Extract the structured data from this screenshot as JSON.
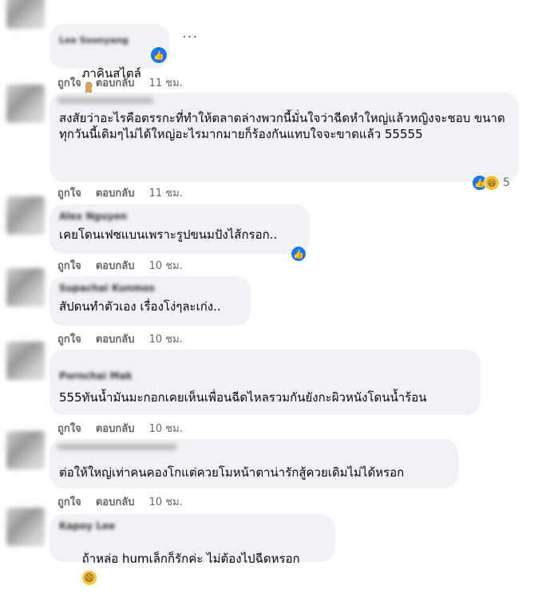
{
  "comments": [
    {
      "author": "Lee Soonyang",
      "text": "ภาคินสไตล์",
      "time": "11 ชม.",
      "emoji": "peanut-icon",
      "reactions": {
        "types": [
          "like-icon"
        ],
        "count": ""
      }
    },
    {
      "author": "",
      "text": "สงสัยว่าอะไรคือตรรกะที่ทำให้ตลาดล่างพวกนี้มั่นใจว่าฉีดหำใหญ่แล้วหญิงจะชอบ ขนาดทุกวันนี้เดิมๆไม่ได้ใหญ่อะไรมากมายก็ร้องกันแทบใจจะขาดแล้ว 55555",
      "time": "11 ชม.",
      "reactions": {
        "types": [
          "like-icon",
          "haha-icon"
        ],
        "count": "5"
      }
    },
    {
      "author": "Alex Nguyen",
      "text": "เคยโดนเฟซแบนเพราะรูปขนมปังไส้กรอก..",
      "time": "10 ชม.",
      "reactions": {
        "types": [
          "like-icon"
        ],
        "count": ""
      }
    },
    {
      "author": "Supachai Kunmos",
      "text": "สัปดนทำตัวเอง เรื่องโง่ๆละเก่ง..",
      "time": "10 ชม."
    },
    {
      "author": "Pornchai Mak",
      "text": "555ทันน้ำมันมะกอกเคยเห็นเพื่อนฉีดไหลรวมกันยังกะผิวหนังโดนน้ำร้อน",
      "time": "10 ชม."
    },
    {
      "author": "",
      "text": "ต่อให้ใหญ่เท่าคนคองโกแต่ควยโมหน้าตาน่ารักสู้ควยเดิมไม่ได้หรอก",
      "time": "10 ชม."
    },
    {
      "author": "Kapoy Lee",
      "text": "ถ้าหล่อ humเล็กก็รักค่ะ ไม่ต้องไปฉีดหรอก",
      "emoji": "grin-icon"
    }
  ],
  "labels": {
    "like": "ถูกใจ",
    "reply": "ตอบกลับ",
    "more": "···"
  }
}
